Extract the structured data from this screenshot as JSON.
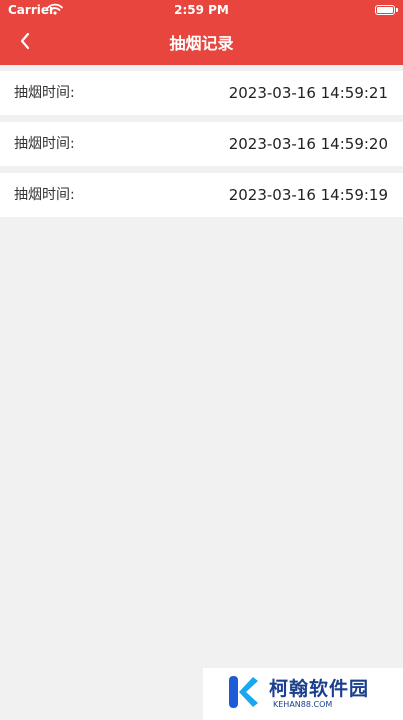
{
  "status_bar": {
    "carrier": "Carrier",
    "time": "2:59 PM",
    "wifi_icon": "wifi-icon",
    "battery_icon": "battery-icon"
  },
  "nav": {
    "title": "抽烟记录",
    "back_icon": "chevron-left-icon"
  },
  "records": [
    {
      "label": "抽烟时间:",
      "time": "2023-03-16 14:59:21"
    },
    {
      "label": "抽烟时间:",
      "time": "2023-03-16 14:59:20"
    },
    {
      "label": "抽烟时间:",
      "time": "2023-03-16 14:59:19"
    }
  ],
  "watermark": {
    "name": "柯翰软件园",
    "site": "KEHAN88.COM"
  },
  "colors": {
    "header": "#e8453e",
    "background": "#f1f1f1",
    "row": "#ffffff",
    "watermark": "#1b3f8f"
  }
}
